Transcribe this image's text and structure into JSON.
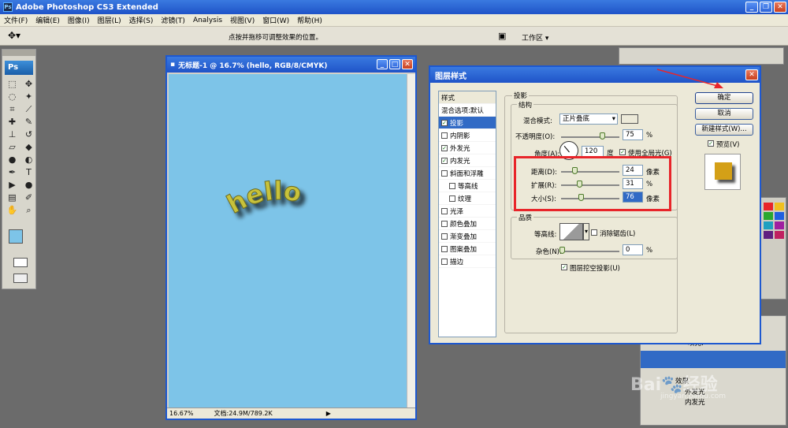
{
  "app": {
    "title": "Adobe Photoshop CS3 Extended",
    "logo": "Ps",
    "menu": [
      "文件(F)",
      "编辑(E)",
      "图像(I)",
      "图层(L)",
      "选择(S)",
      "滤镜(T)",
      "Analysis",
      "视图(V)",
      "窗口(W)",
      "帮助(H)"
    ],
    "options_hint": "点按并拖移可调整效果的位置。",
    "workspace_label": "工作区 ▾"
  },
  "document": {
    "title": "无标题-1 @ 16.7% (hello, RGB/8/CMYK)",
    "canvas_text": "hello",
    "zoom": "16.67%",
    "doc_info": "文档:24.9M/789.2K"
  },
  "dialog": {
    "title": "图层样式",
    "styles_header": "样式",
    "blend_options": "混合选项:默认",
    "style_items": [
      {
        "label": "投影",
        "checked": true,
        "selected": true
      },
      {
        "label": "内阴影",
        "checked": false
      },
      {
        "label": "外发光",
        "checked": true
      },
      {
        "label": "内发光",
        "checked": true
      },
      {
        "label": "斜面和浮雕",
        "checked": false
      },
      {
        "label": "等高线",
        "checked": false,
        "indent": true
      },
      {
        "label": "纹理",
        "checked": false,
        "indent": true
      },
      {
        "label": "光泽",
        "checked": false
      },
      {
        "label": "颜色叠加",
        "checked": false
      },
      {
        "label": "渐变叠加",
        "checked": false
      },
      {
        "label": "图案叠加",
        "checked": false
      },
      {
        "label": "描边",
        "checked": false
      }
    ],
    "section_title": "投影",
    "structure_title": "结构",
    "blend_mode_label": "混合模式:",
    "blend_mode_value": "正片叠底",
    "opacity_label": "不透明度(O):",
    "opacity_value": "75",
    "angle_label": "角度(A):",
    "angle_value": "120",
    "angle_unit": "度",
    "global_light_label": "使用全局光(G)",
    "distance_label": "距离(D):",
    "distance_value": "24",
    "spread_label": "扩展(R):",
    "spread_value": "31",
    "size_label": "大小(S):",
    "size_value": "76",
    "unit_px": "像素",
    "unit_pct": "%",
    "quality_title": "品质",
    "contour_label": "等高线:",
    "antialias_label": "消除锯齿(L)",
    "noise_label": "杂色(N):",
    "noise_value": "0",
    "knockout_label": "图层挖空投影(U)",
    "ok_label": "确定",
    "cancel_label": "取消",
    "new_style_label": "新建样式(W)...",
    "preview_label": "预览(V)",
    "shadow_color": "#000000",
    "swatch_color": "#d4a017"
  },
  "right_panels": {
    "layer_items": [
      "效果",
      "外发光",
      "内发光"
    ],
    "fill_label": "填充:"
  },
  "colors": {
    "canvas": "#7dc4e8",
    "text_fill": "#c8c23a",
    "highlight": "#e8252a"
  }
}
